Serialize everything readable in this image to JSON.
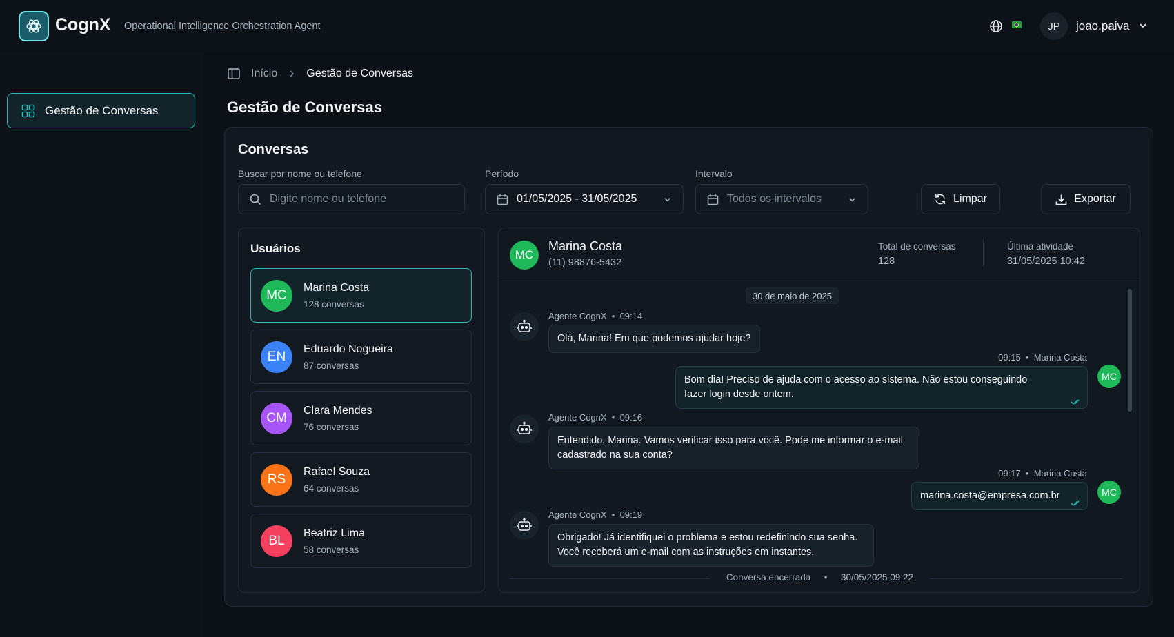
{
  "header": {
    "brand": "CognX",
    "tagline": "Operational Intelligence Orchestration Agent",
    "user_initials": "JP",
    "username": "joao.paiva"
  },
  "sidebar": {
    "items": [
      {
        "label": "Gestão de Conversas"
      }
    ]
  },
  "breadcrumb": {
    "home": "Início",
    "current": "Gestão de Conversas"
  },
  "page_title": "Gestão de Conversas",
  "conversas": {
    "title": "Conversas",
    "search": {
      "label": "Buscar por nome ou telefone",
      "placeholder": "Digite nome ou telefone"
    },
    "period": {
      "label": "Período",
      "value": "01/05/2025 - 31/05/2025"
    },
    "interval": {
      "label": "Intervalo",
      "value": "Todos os intervalos"
    },
    "clear_label": "Limpar",
    "export_label": "Exportar"
  },
  "users": {
    "title": "Usuários",
    "list": [
      {
        "initials": "MC",
        "name": "Marina Costa",
        "count": "128 conversas",
        "color": "#1fb95a"
      },
      {
        "initials": "EN",
        "name": "Eduardo Nogueira",
        "count": "87 conversas",
        "color": "#3b82f6"
      },
      {
        "initials": "CM",
        "name": "Clara Mendes",
        "count": "76 conversas",
        "color": "#a855f7"
      },
      {
        "initials": "RS",
        "name": "Rafael Souza",
        "count": "64 conversas",
        "color": "#f97316"
      },
      {
        "initials": "BL",
        "name": "Beatriz Lima",
        "count": "58 conversas",
        "color": "#f43f5e"
      }
    ]
  },
  "chat": {
    "contact": {
      "initials": "MC",
      "name": "Marina Costa",
      "phone": "(11) 98876-5432"
    },
    "stats": [
      {
        "label": "Total de conversas",
        "value": "128"
      },
      {
        "label": "Última atividade",
        "value": "31/05/2025 10:42"
      }
    ],
    "date_chip": "30 de maio de 2025",
    "messages": [
      {
        "from": "bot",
        "meta_name": "Agente CognX",
        "meta_time": "09:14",
        "text": "Olá, Marina! Em que podemos ajudar hoje?"
      },
      {
        "from": "user",
        "meta_time": "09:15",
        "meta_name": "Marina Costa",
        "initials": "MC",
        "text_line1": "Bom dia! Preciso de ajuda com o acesso ao sistema. Não estou conseguindo",
        "text_line2": "fazer login desde ontem."
      },
      {
        "from": "bot",
        "meta_name": "Agente CognX",
        "meta_time": "09:16",
        "text_line1": "Entendido, Marina. Vamos verificar isso para você. Pode me informar o e-mail",
        "text_line2": "cadastrado na sua conta?"
      },
      {
        "from": "user",
        "meta_time": "09:17",
        "meta_name": "Marina Costa",
        "initials": "MC",
        "text": "marina.costa@empresa.com.br"
      },
      {
        "from": "bot",
        "meta_name": "Agente CognX",
        "meta_time": "09:19",
        "text_line1": "Obrigado! Já identifiquei o problema e estou redefinindo sua senha.",
        "text_line2": "Você receberá um e-mail com as instruções em instantes."
      }
    ],
    "end_label": "Conversa encerrada",
    "end_time": "30/05/2025 09:22"
  },
  "colors": {
    "accent": "#2bb9b5",
    "background": "#0c1117",
    "panel": "#111820"
  }
}
